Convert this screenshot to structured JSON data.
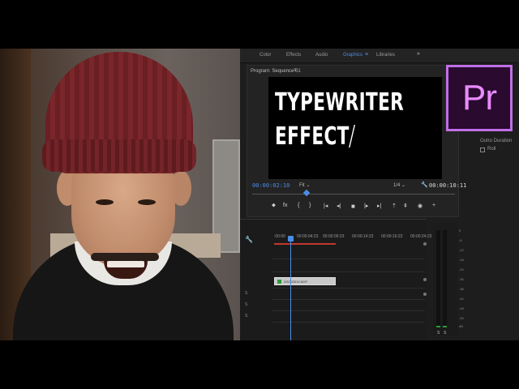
{
  "workspace_tabs": [
    {
      "label": "Color",
      "active": false
    },
    {
      "label": "Effects",
      "active": false
    },
    {
      "label": "Audio",
      "active": false
    },
    {
      "label": "Graphics",
      "active": true
    },
    {
      "label": "Libraries",
      "active": false
    }
  ],
  "workspace_menu_icon": "≡",
  "workspace_more_icon": "»",
  "program_monitor": {
    "title": "Program: Sequence 01",
    "menu_icon": "≡",
    "video_text_line1": "TYPEWRITER",
    "video_text_line2": "EFFECT",
    "current_timecode": "00:00:02:10",
    "fit_label": "Fit",
    "fit_caret": "⌄",
    "resolution": "1/4",
    "resolution_caret": "⌄",
    "duration_timecode": "00:00:10:11"
  },
  "transport_buttons": [
    {
      "name": "marker-icon",
      "glyph": "⬥"
    },
    {
      "name": "fx-icon",
      "glyph": "fx"
    },
    {
      "name": "mark-in-icon",
      "glyph": "{"
    },
    {
      "name": "mark-out-icon",
      "glyph": "}"
    },
    {
      "name": "go-to-in-icon",
      "glyph": "|◂"
    },
    {
      "name": "step-back-icon",
      "glyph": "◂|"
    },
    {
      "name": "play-stop-icon",
      "glyph": "■"
    },
    {
      "name": "step-forward-icon",
      "glyph": "|▸"
    },
    {
      "name": "go-to-out-icon",
      "glyph": "▸|"
    },
    {
      "name": "lift-icon",
      "glyph": "⇡"
    },
    {
      "name": "extract-icon",
      "glyph": "⇞"
    },
    {
      "name": "export-frame-icon",
      "glyph": "◉"
    },
    {
      "name": "add-button-icon",
      "glyph": "+"
    }
  ],
  "logo_text": "Pr",
  "logo_colors": {
    "border": "#c06fe6",
    "text": "#e98bff",
    "bg": "#2a0a2f"
  },
  "effect_controls": {
    "duration_label": "Outro Duration",
    "checkbox_label": "Roll"
  },
  "timeline": {
    "ruler_ticks": [
      ":00:00",
      "00:00:04:23",
      "00:00:09:23",
      "00:00:14:23",
      "00:00:19:23",
      "00:00:24:23"
    ],
    "clip_label": "DSC02515.MXF",
    "track_labels": [
      "S",
      "S",
      "S"
    ]
  },
  "meters": {
    "scale": [
      "0",
      "-6",
      "-12",
      "-18",
      "-24",
      "-30",
      "-36",
      "-42",
      "-48",
      "-54",
      "dB"
    ],
    "solo_labels": [
      "S",
      "S"
    ]
  },
  "accent_color": "#4b8de6"
}
